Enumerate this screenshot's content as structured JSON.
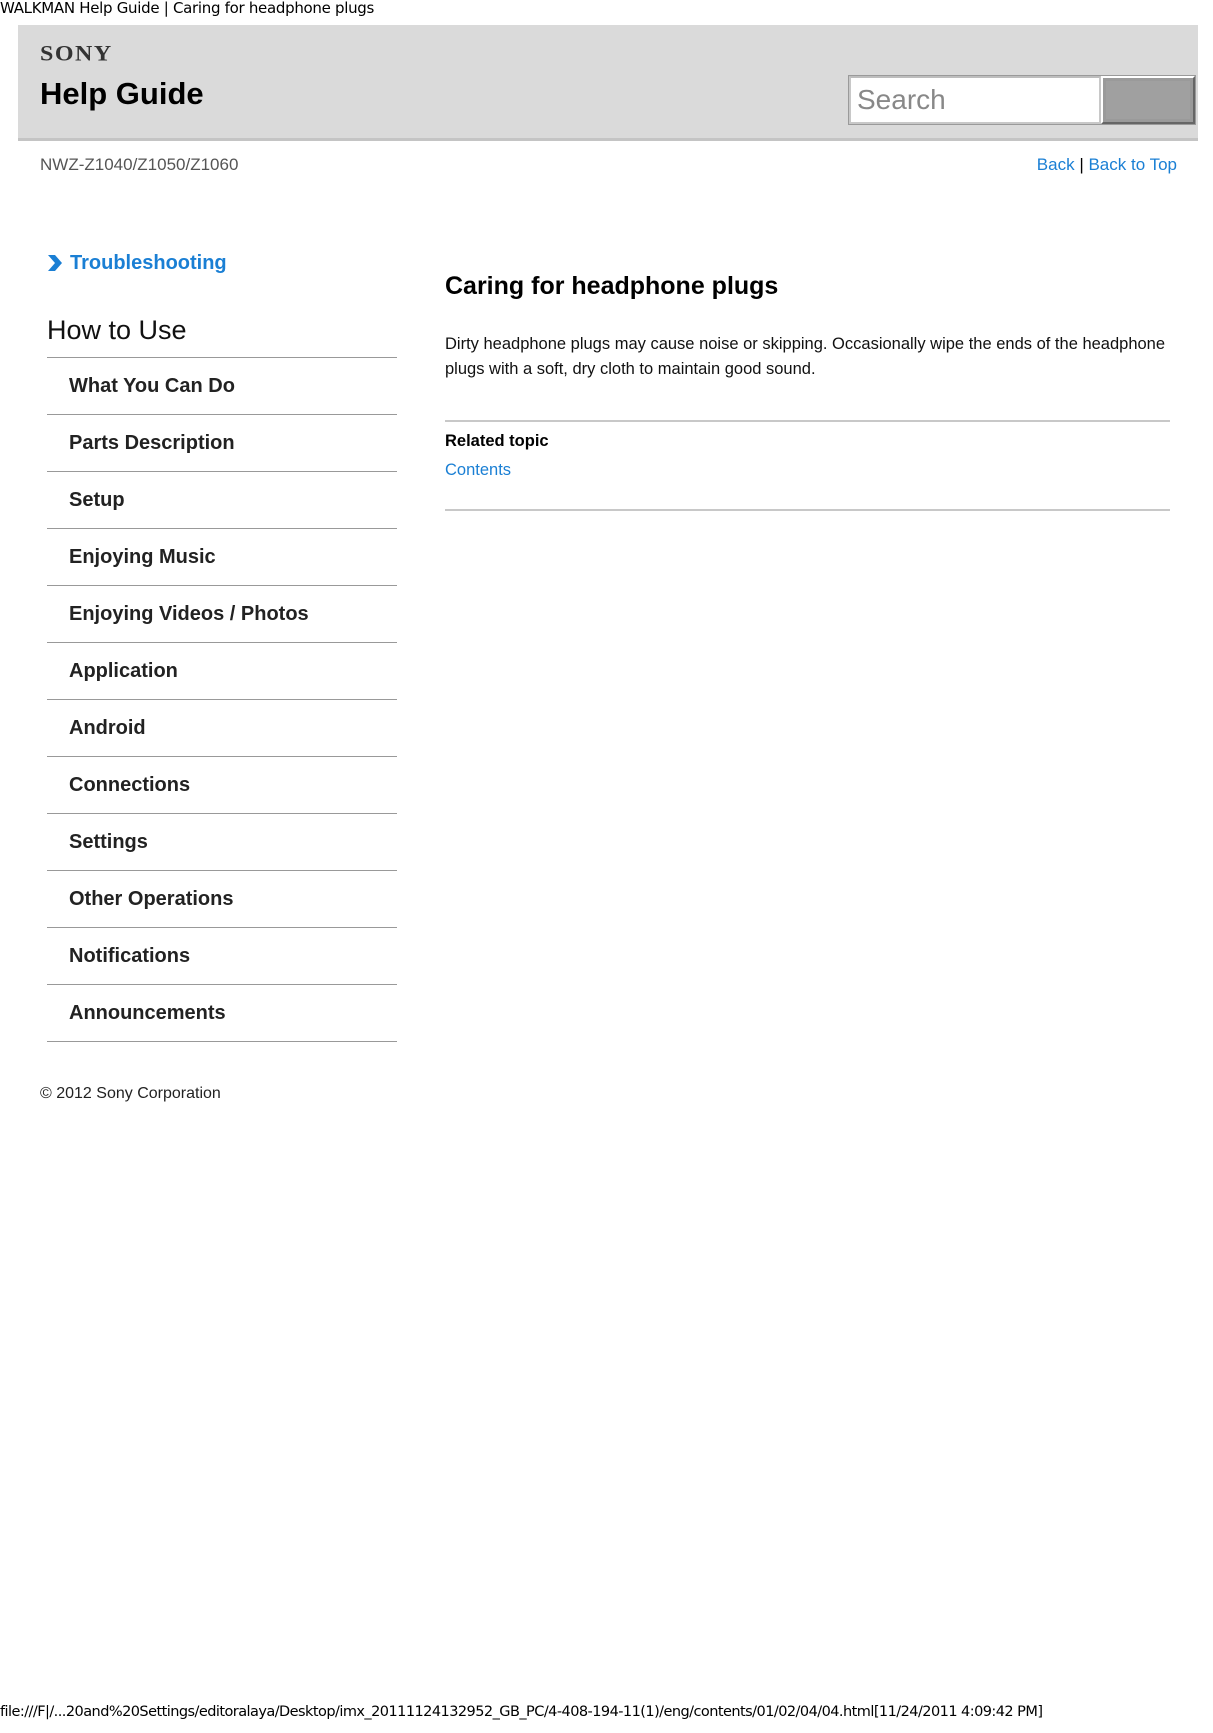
{
  "document_title": "WALKMAN Help Guide | Caring for headphone plugs",
  "header": {
    "logo": "SONY",
    "title": "Help Guide",
    "search": {
      "placeholder": "Search",
      "value": ""
    }
  },
  "subheader": {
    "model": "NWZ-Z1040/Z1050/Z1060",
    "back_label": "Back",
    "separator": "|",
    "back_to_top_label": "Back to Top"
  },
  "sidebar": {
    "troubleshooting_label": "Troubleshooting",
    "section_title": "How to Use",
    "items": [
      {
        "label": "What You Can Do"
      },
      {
        "label": "Parts Description"
      },
      {
        "label": "Setup"
      },
      {
        "label": "Enjoying Music"
      },
      {
        "label": "Enjoying Videos / Photos"
      },
      {
        "label": "Application"
      },
      {
        "label": "Android"
      },
      {
        "label": "Connections"
      },
      {
        "label": "Settings"
      },
      {
        "label": "Other Operations"
      },
      {
        "label": "Notifications"
      },
      {
        "label": "Announcements"
      }
    ],
    "copyright": "© 2012 Sony Corporation"
  },
  "main": {
    "title": "Caring for headphone plugs",
    "body": "Dirty headphone plugs may cause noise or skipping. Occasionally wipe the ends of the headphone plugs with a soft, dry cloth to maintain good sound.",
    "related_title": "Related topic",
    "related_links": [
      {
        "label": "Contents"
      }
    ]
  },
  "footer": {
    "path": "file:///F|/...20and%20Settings/editoralaya/Desktop/imx_20111124132952_GB_PC/4-408-194-11(1)/eng/contents/01/02/04/04.html[11/24/2011 4:09:42 PM]"
  },
  "colors": {
    "link": "#1a7fd4",
    "header_bg": "#dadada",
    "divider": "#999999"
  }
}
